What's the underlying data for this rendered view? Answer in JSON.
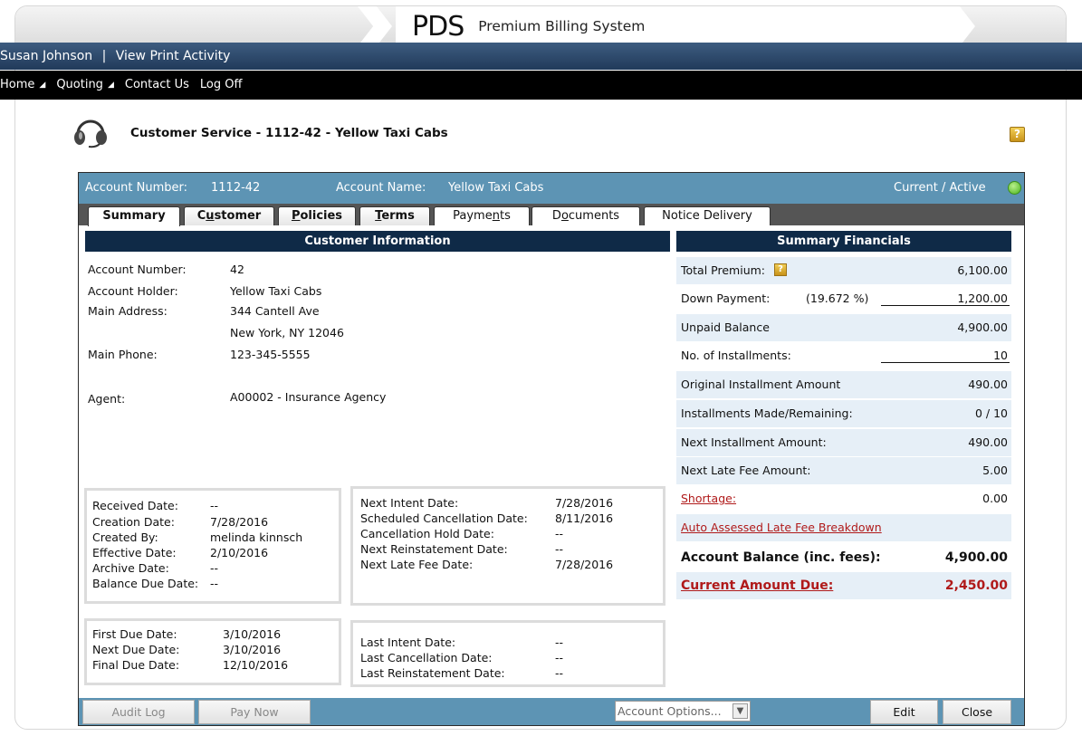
{
  "header": {
    "logo_mark": "PDS",
    "system_name": "Premium Billing System"
  },
  "userbar": {
    "user": "Susan Johnson",
    "separator": "|",
    "link": "View Print Activity"
  },
  "menu": [
    {
      "label": "Home",
      "arrow": "◢"
    },
    {
      "label": "Quoting",
      "arrow": "◢"
    },
    {
      "label": "Contact Us",
      "arrow": ""
    },
    {
      "label": "Log Off",
      "arrow": ""
    }
  ],
  "page": {
    "title": "Customer Service - 1112-42 - Yellow Taxi Cabs",
    "help": "?"
  },
  "account_bar": {
    "number_label": "Account Number:",
    "number": "1112-42",
    "name_label": "Account Name:",
    "name": "Yellow Taxi Cabs",
    "status": "Current / Active"
  },
  "tabs": [
    {
      "label": "Summary",
      "underline": ""
    },
    {
      "label": "Customer",
      "underline": "u"
    },
    {
      "label": "Policies",
      "underline": "P"
    },
    {
      "label": "Terms",
      "underline": "T"
    },
    {
      "label": "Payments",
      "underline": "n"
    },
    {
      "label": "Documents",
      "underline": "o"
    },
    {
      "label": "Notice Delivery",
      "underline": ""
    }
  ],
  "customer_info": {
    "heading": "Customer Information",
    "rows": [
      {
        "label": "Account Number:",
        "value": "42"
      },
      {
        "label": "Account Holder:",
        "value": "Yellow Taxi Cabs"
      },
      {
        "label": "Main Address:",
        "value": "344 Cantell Ave"
      },
      {
        "label": "",
        "value": "New York, NY 12046"
      },
      {
        "label": "Main Phone:",
        "value": "123-345-5555"
      },
      {
        "label": "Agent:",
        "value": "A00002 - Insurance Agency"
      }
    ]
  },
  "dates_box": [
    {
      "label": "Received Date:",
      "value": "--"
    },
    {
      "label": "Creation Date:",
      "value": "7/28/2016"
    },
    {
      "label": "Created By:",
      "value": "melinda kinnsch"
    },
    {
      "label": "Effective Date:",
      "value": "2/10/2016"
    },
    {
      "label": "Archive Date:",
      "value": "--"
    },
    {
      "label": "Balance Due Date:",
      "value": "--"
    }
  ],
  "intent_box": [
    {
      "label": "Next Intent Date:",
      "value": "7/28/2016"
    },
    {
      "label": "Scheduled Cancellation Date:",
      "value": "8/11/2016"
    },
    {
      "label": "Cancellation Hold Date:",
      "value": "--"
    },
    {
      "label": "Next Reinstatement Date:",
      "value": "--"
    },
    {
      "label": "Next Late Fee Date:",
      "value": "7/28/2016"
    }
  ],
  "due_box": [
    {
      "label": "First Due Date:",
      "value": "3/10/2016"
    },
    {
      "label": "Next Due Date:",
      "value": "3/10/2016"
    },
    {
      "label": "Final Due Date:",
      "value": "12/10/2016"
    }
  ],
  "last_box": [
    {
      "label": "Last Intent Date:",
      "value": "--"
    },
    {
      "label": "Last Cancellation Date:",
      "value": "--"
    },
    {
      "label": "Last Reinstatement Date:",
      "value": "--"
    }
  ],
  "financials": {
    "heading": "Summary Financials",
    "total_premium_label": "Total Premium:",
    "total_premium": "6,100.00",
    "down_payment_label": "Down Payment:",
    "down_payment_pct": "(19.672 %)",
    "down_payment": "1,200.00",
    "unpaid_label": "Unpaid Balance",
    "unpaid": "4,900.00",
    "installments_label": "No. of Installments:",
    "installments": "10",
    "orig_inst_label": "Original Installment Amount",
    "orig_inst": "490.00",
    "made_label": "Installments Made/Remaining:",
    "made": "0 / 10",
    "next_inst_label": "Next Installment Amount:",
    "next_inst": "490.00",
    "late_fee_label": "Next Late Fee Amount:",
    "late_fee": "5.00",
    "shortage_label": "Shortage:",
    "shortage": "0.00",
    "late_breakdown_label": "Auto Assessed Late Fee Breakdown",
    "balance_label": "Account Balance (inc. fees):",
    "balance": "4,900.00",
    "due_label": "Current Amount Due:",
    "due": "2,450.00"
  },
  "bottom": {
    "audit": "Audit Log",
    "pay": "Pay Now",
    "options_placeholder": "Account Options...",
    "edit": "Edit",
    "close": "Close"
  },
  "colors": {
    "accent_bar": "#5d94b4",
    "nav_dark": "#0f2a47",
    "status_green": "#49b21c",
    "alert_red": "#b01a1a"
  }
}
